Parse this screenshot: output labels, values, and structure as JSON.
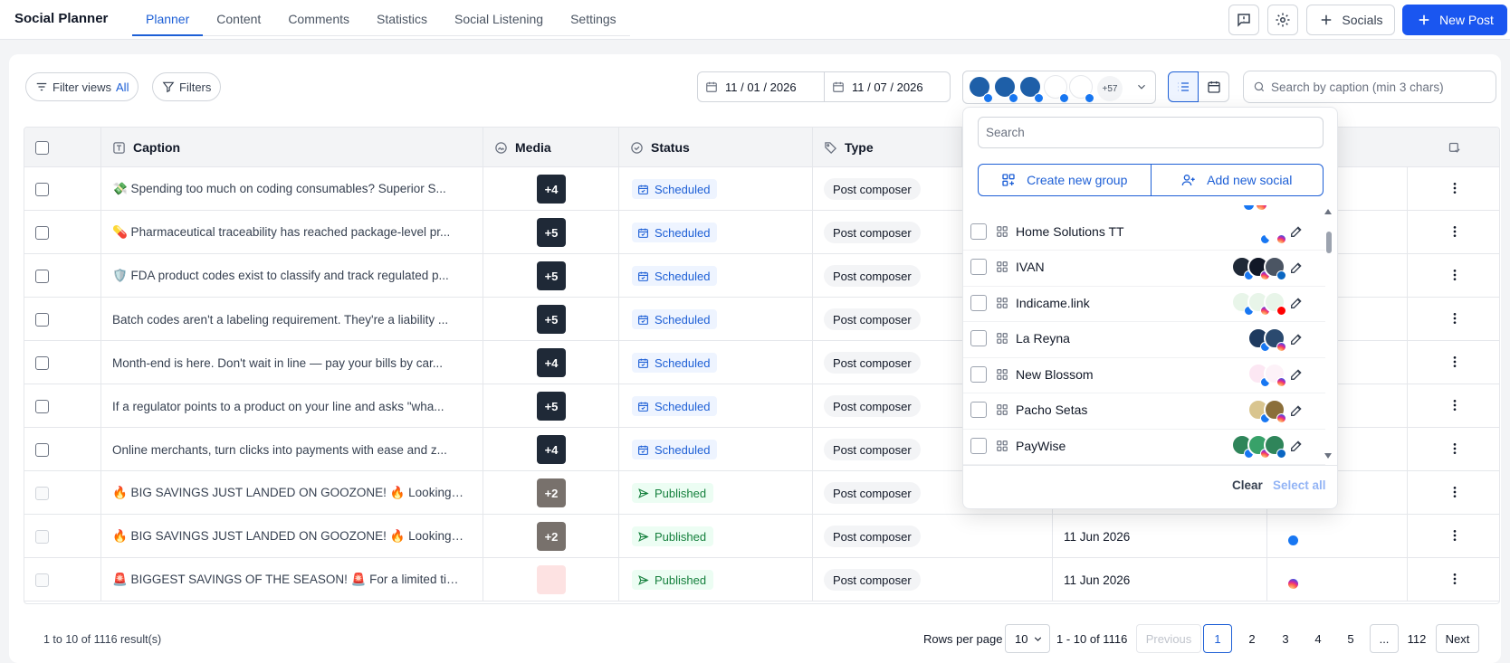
{
  "app": {
    "brand": "Social Planner"
  },
  "nav": [
    "Planner",
    "Content",
    "Comments",
    "Statistics",
    "Social Listening",
    "Settings"
  ],
  "topbar": {
    "socials_label": "Socials",
    "new_post_label": "New Post"
  },
  "toolbar": {
    "filter_views_label": "Filter views",
    "filter_views_value": "All",
    "filters_label": "Filters",
    "date_from": "11 / 01 / 2026",
    "date_to": "11 / 07 / 2026",
    "accounts_more": "+57",
    "search_placeholder": "Search by caption (min 3 chars)"
  },
  "table": {
    "headers": {
      "caption": "Caption",
      "media": "Media",
      "status": "Status",
      "type": "Type"
    },
    "rows": [
      {
        "caption": "💸 Spending too much on coding consumables? Superior S...",
        "media": "+4",
        "status": "Scheduled",
        "type": "Post composer",
        "date": ""
      },
      {
        "caption": "💊 Pharmaceutical traceability has reached package-level pr...",
        "media": "+5",
        "status": "Scheduled",
        "type": "Post composer",
        "date": ""
      },
      {
        "caption": "🛡️ FDA product codes exist to classify and track regulated p...",
        "media": "+5",
        "status": "Scheduled",
        "type": "Post composer",
        "date": ""
      },
      {
        "caption": "Batch codes aren't a labeling requirement. They're a liability ...",
        "media": "+5",
        "status": "Scheduled",
        "type": "Post composer",
        "date": ""
      },
      {
        "caption": "Month-end is here. Don't wait in line — pay your bills by car...",
        "media": "+4",
        "status": "Scheduled",
        "type": "Post composer",
        "date": ""
      },
      {
        "caption": "If a regulator points to a product on your line and asks \"wha...",
        "media": "+5",
        "status": "Scheduled",
        "type": "Post composer",
        "date": ""
      },
      {
        "caption": "Online merchants, turn clicks into payments with ease and z...",
        "media": "+4",
        "status": "Scheduled",
        "type": "Post composer",
        "date": ""
      },
      {
        "caption": "🔥 BIG SAVINGS JUST LANDED ON GOOZONE! 🔥 Looking ...",
        "media": "+2",
        "status": "Published",
        "type": "Post composer",
        "date": ""
      },
      {
        "caption": "🔥 BIG SAVINGS JUST LANDED ON GOOZONE! 🔥 Looking ...",
        "media": "+2",
        "status": "Published",
        "type": "Post composer",
        "date": "11 Jun 2026"
      },
      {
        "caption": "🚨 BIGGEST SAVINGS OF THE SEASON! 🚨 For a limited tim...",
        "media": "",
        "status": "Published",
        "type": "Post composer",
        "date": "11 Jun 2026"
      }
    ]
  },
  "footer": {
    "results": "1 to 10 of 1116 result(s)",
    "rows_per_page_label": "Rows per page",
    "rows_per_page": "10",
    "range": "1 - 10 of 1116",
    "previous": "Previous",
    "pages": [
      "1",
      "2",
      "3",
      "4",
      "5"
    ],
    "ellipsis": "...",
    "last_page": "112",
    "next": "Next"
  },
  "dropdown": {
    "search_placeholder": "Search",
    "create_group": "Create new group",
    "add_social": "Add new social",
    "groups": [
      {
        "name": "Home Solutions TT"
      },
      {
        "name": "IVAN"
      },
      {
        "name": "Indicame.link"
      },
      {
        "name": "La Reyna"
      },
      {
        "name": "New Blossom"
      },
      {
        "name": "Pacho Setas"
      },
      {
        "name": "PayWise"
      }
    ],
    "clear": "Clear",
    "select_all": "Select all"
  },
  "colors": {
    "accent": "#1d5fd6",
    "primary_button": "#1a56f0",
    "scheduled": "#1d5fd6",
    "published": "#15803d"
  }
}
